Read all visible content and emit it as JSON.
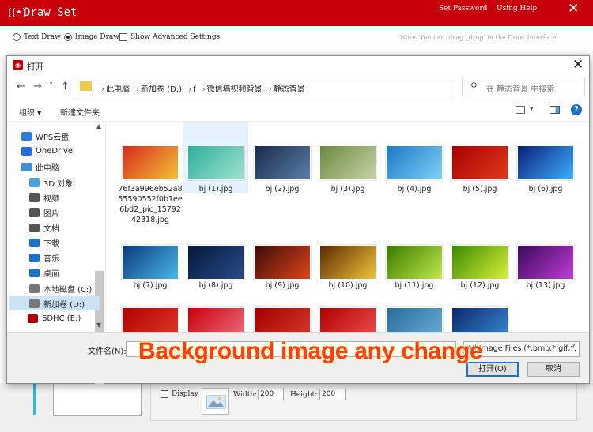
{
  "app": {
    "title": "Draw Set",
    "menu": {
      "set_password": "Set Password",
      "using_help": "Using Help"
    },
    "close_glyph": "✕",
    "modes": {
      "text_draw": "Text Draw",
      "image_draw": "Image Draw",
      "advanced": "Show Advanced Settings",
      "selected": "image_draw"
    },
    "note": "Note: You can 'drag _drop' in the Draw Interface",
    "display_label": "Display",
    "width_label": "Width:",
    "width_value": "200",
    "height_label": "Height:",
    "height_value": "200"
  },
  "dialog": {
    "title": "打开",
    "close_glyph": "✕",
    "nav_arrows": {
      "back": "←",
      "forward": "→",
      "dropdown": "˅",
      "up": "↑"
    },
    "breadcrumb": [
      "此电脑",
      "新加卷 (D:)",
      "f",
      "微信墙视频背景",
      "静态背景"
    ],
    "search_placeholder": "在 静态背景 中搜索",
    "toolbar": {
      "organize": "组织 ▾",
      "new_folder": "新建文件夹"
    },
    "nav_items": [
      {
        "label": "WPS云盘",
        "color": "#2b7de0"
      },
      {
        "label": "OneDrive",
        "color": "#1e6fd9"
      },
      {
        "label": "此电脑",
        "color": "#3d8fd6"
      },
      {
        "label": "3D 对象",
        "color": "#4aa3df"
      },
      {
        "label": "视频",
        "color": "#555555"
      },
      {
        "label": "图片",
        "color": "#555555"
      },
      {
        "label": "文档",
        "color": "#555555"
      },
      {
        "label": "下载",
        "color": "#1e73c8"
      },
      {
        "label": "音乐",
        "color": "#1e73c8"
      },
      {
        "label": "桌面",
        "color": "#1e73c8"
      },
      {
        "label": "本地磁盘 (C:)",
        "color": "#777777"
      },
      {
        "label": "新加卷 (D:)",
        "color": "#777777"
      },
      {
        "label": "SDHC (E:)",
        "color": "#b0000a"
      }
    ],
    "selected_nav": "新加卷 (D:)",
    "files": [
      {
        "name": "76f3a996eb52a855590552f0b1ee6bd2_pic_1579242318.jpg",
        "colors": [
          "#d62a1a",
          "#f4c23a"
        ]
      },
      {
        "name": "bj (1).jpg",
        "colors": [
          "#2cae9a",
          "#9fe3d0"
        ]
      },
      {
        "name": "bj (2).jpg",
        "colors": [
          "#1a2a4a",
          "#5a7fa8"
        ]
      },
      {
        "name": "bj (3).jpg",
        "colors": [
          "#6a8a3c",
          "#c8d3a8"
        ]
      },
      {
        "name": "bj (4).jpg",
        "colors": [
          "#1c78c8",
          "#7fd0f6"
        ]
      },
      {
        "name": "bj (5).jpg",
        "colors": [
          "#a80000",
          "#e03a1a"
        ]
      },
      {
        "name": "bj (6).jpg",
        "colors": [
          "#0b1f7a",
          "#3bb0ff"
        ]
      },
      {
        "name": "bj (7).jpg",
        "colors": [
          "#0a3a7a",
          "#49b7ea"
        ]
      },
      {
        "name": "bj (8).jpg",
        "colors": [
          "#041a3a",
          "#2a4a8a"
        ]
      },
      {
        "name": "bj (9).jpg",
        "colors": [
          "#3a0a0a",
          "#e0451a"
        ]
      },
      {
        "name": "bj (10).jpg",
        "colors": [
          "#5a2a00",
          "#f2c23a"
        ]
      },
      {
        "name": "bj (11).jpg",
        "colors": [
          "#3a7a00",
          "#c0e84a"
        ]
      },
      {
        "name": "bj (12).jpg",
        "colors": [
          "#3a8a00",
          "#d8f03a"
        ]
      },
      {
        "name": "bj (13).jpg",
        "colors": [
          "#3a0a5a",
          "#c03ad8"
        ]
      },
      {
        "name": "",
        "colors": [
          "#b00000",
          "#e03a2a"
        ]
      },
      {
        "name": "",
        "colors": [
          "#c8000a",
          "#f07080"
        ]
      },
      {
        "name": "",
        "colors": [
          "#a00000",
          "#d83a2a"
        ]
      },
      {
        "name": "",
        "colors": [
          "#b00000",
          "#f05050"
        ]
      },
      {
        "name": "",
        "colors": [
          "#2a6a9a",
          "#6ab0d8"
        ]
      },
      {
        "name": "",
        "colors": [
          "#0a2a6a",
          "#3a8ad8"
        ]
      }
    ],
    "filename_label": "文件名(N):",
    "filename_value": "",
    "filetype": "All Image Files (*.bmp;*.gif;*.",
    "open_button": "打开(O)",
    "cancel_button": "取消"
  },
  "caption": "Background image any change"
}
